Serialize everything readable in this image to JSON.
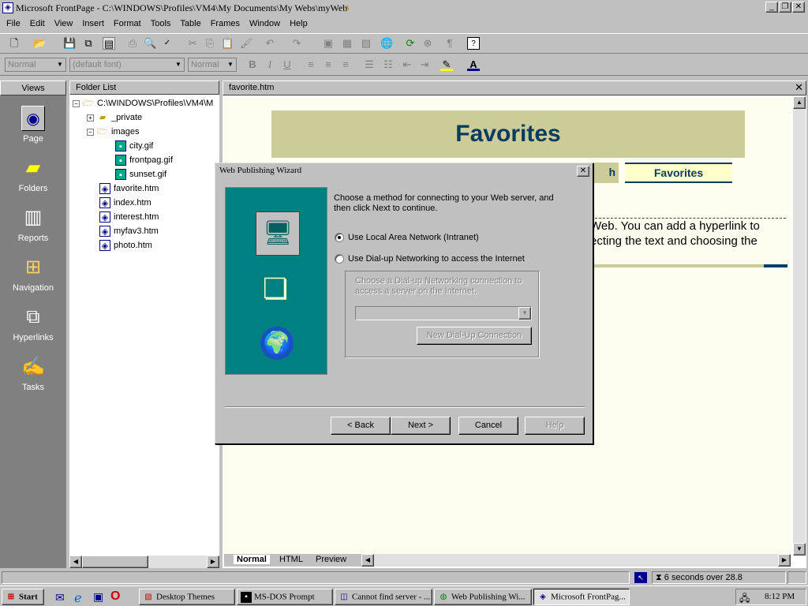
{
  "window": {
    "title": "Microsoft FrontPage - C:\\WINDOWS\\Profiles\\VM4\\My Documents\\My Webs\\myWeb"
  },
  "menu": [
    "File",
    "Edit",
    "View",
    "Insert",
    "Format",
    "Tools",
    "Table",
    "Frames",
    "Window",
    "Help"
  ],
  "format_toolbar": {
    "style": "Normal",
    "font": "(default font)",
    "size": "Normal",
    "bold": "B",
    "italic": "I",
    "underline": "U"
  },
  "views": {
    "header": "Views",
    "items": [
      {
        "label": "Page",
        "icon": "page-view-icon",
        "selected": true
      },
      {
        "label": "Folders",
        "icon": "folders-view-icon"
      },
      {
        "label": "Reports",
        "icon": "reports-view-icon"
      },
      {
        "label": "Navigation",
        "icon": "navigation-view-icon"
      },
      {
        "label": "Hyperlinks",
        "icon": "hyperlinks-view-icon"
      },
      {
        "label": "Tasks",
        "icon": "tasks-view-icon"
      }
    ]
  },
  "folder_list": {
    "header": "Folder List",
    "root": "C:\\WINDOWS\\Profiles\\VM4\\M",
    "items": [
      {
        "label": "_private",
        "type": "folder"
      },
      {
        "label": "images",
        "type": "folder"
      },
      {
        "label": "city.gif",
        "type": "image"
      },
      {
        "label": "frontpag.gif",
        "type": "image"
      },
      {
        "label": "sunset.gif",
        "type": "image"
      },
      {
        "label": "favorite.htm",
        "type": "page"
      },
      {
        "label": "index.htm",
        "type": "page"
      },
      {
        "label": "interest.htm",
        "type": "page"
      },
      {
        "label": "myfav3.htm",
        "type": "page"
      },
      {
        "label": "photo.htm",
        "type": "page"
      }
    ]
  },
  "editor": {
    "file": "favorite.htm",
    "banner": "Favorites",
    "nav_partial": "h",
    "nav_favorites": "Favorites",
    "body_line1": "Web. You can add a hyperlink to",
    "body_line2": "ecting the text and choosing the",
    "tabs": [
      "Normal",
      "HTML",
      "Preview"
    ]
  },
  "dialog": {
    "title": "Web Publishing Wizard",
    "instruction": "Choose a method for connecting to your Web server, and then click Next to continue.",
    "option_lan": "Use Local Area Network (Intranet)",
    "option_dialup": "Use Dial-up Networking to access the Internet",
    "dialup_group_label": "Choose a Dial-up Networking connection to access a server on the Internet.",
    "dialup_selected": "",
    "new_connection": "New Dial-Up Connection",
    "back": "< Back",
    "next": "Next >",
    "cancel": "Cancel",
    "help": "Help"
  },
  "status": {
    "download_time": "6 seconds over 28.8"
  },
  "taskbar": {
    "start": "Start",
    "tasks": [
      "Desktop Themes",
      "MS-DOS Prompt",
      "Cannot find server - ...",
      "Web Publishing Wi...",
      "Microsoft FrontPag..."
    ],
    "clock": "8:12 PM"
  }
}
